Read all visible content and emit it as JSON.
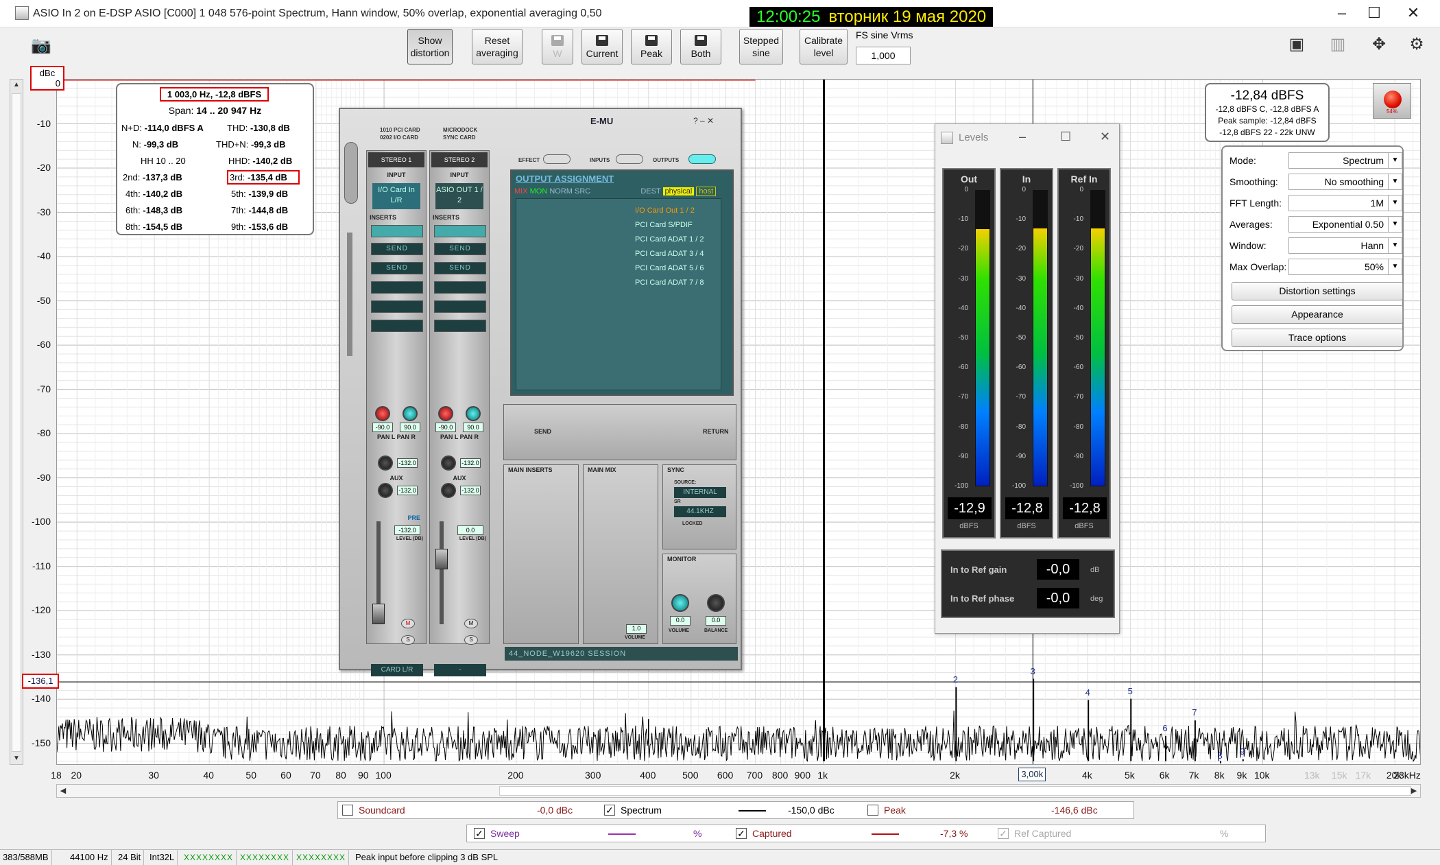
{
  "window": {
    "title": "ASIO In 2 on E-DSP ASIO [C000] 1 048 576-point Spectrum, Hann window, 50% overlap, exponential averaging 0,50",
    "clock_time": "12:00:25",
    "clock_date": "вторник 19 мая 2020"
  },
  "toolbar": {
    "show_distortion": "Show distortion",
    "reset_averaging": "Reset averaging",
    "w": "W",
    "current": "Current",
    "peak": "Peak",
    "both": "Both",
    "stepped_sine": "Stepped sine",
    "calibrate_level": "Calibrate level",
    "fs_sine_label": "FS sine Vrms",
    "fs_sine_value": "1,000"
  },
  "plot": {
    "y_unit": "dBc",
    "y_top": "0",
    "y_labels": [
      "-10",
      "-20",
      "-30",
      "-40",
      "-50",
      "-60",
      "-70",
      "-80",
      "-90",
      "-100",
      "-110",
      "-120",
      "-130",
      "-140",
      "-150"
    ],
    "cursor_level": "-136,1",
    "x_labels": [
      "18",
      "20",
      "30",
      "40",
      "50",
      "60",
      "70",
      "80",
      "90",
      "100",
      "200",
      "300",
      "400",
      "500",
      "600",
      "700",
      "800",
      "900",
      "1k",
      "2k",
      "3,00k",
      "4k",
      "5k",
      "6k",
      "7k",
      "8k",
      "9k",
      "10k",
      "13k",
      "15k",
      "17k",
      "20k",
      "23kHz"
    ],
    "cursor_freq": "3,00k",
    "harmonics": [
      "2",
      "3",
      "4",
      "5",
      "6",
      "7",
      "8",
      "9"
    ]
  },
  "chart_data": {
    "type": "line",
    "x_scale": "log",
    "x_unit": "Hz",
    "y_unit": "dBc",
    "ylim": [
      -155,
      0
    ],
    "xlim": [
      18,
      23000
    ],
    "noise_floor_db": -150,
    "cursor_level_db": -136.1,
    "cursor_freq_hz": 3000,
    "peaks": [
      {
        "label": "1",
        "freq": 1003,
        "db": 0
      },
      {
        "label": "2",
        "freq": 2006,
        "db": -137.3
      },
      {
        "label": "3",
        "freq": 3009,
        "db": -135.4
      },
      {
        "label": "4",
        "freq": 4012,
        "db": -140.2
      },
      {
        "label": "5",
        "freq": 5015,
        "db": -139.9
      },
      {
        "label": "6",
        "freq": 6018,
        "db": -148.3
      },
      {
        "label": "7",
        "freq": 7021,
        "db": -144.8
      },
      {
        "label": "8",
        "freq": 8024,
        "db": -154.5
      },
      {
        "label": "9",
        "freq": 9027,
        "db": -153.6
      }
    ]
  },
  "distortion": {
    "header": "1 003,0 Hz, -12,8 dBFS",
    "span_label": "Span:",
    "span_value": "14 .. 20 947 Hz",
    "nd_label": "N+D:",
    "nd_value": "-114,0 dBFS A",
    "thd_label": "THD:",
    "thd_value": "-130,8 dB",
    "n_label": "N:",
    "n_value": "-99,3 dB",
    "thdn_label": "THD+N:",
    "thdn_value": "-99,3 dB",
    "hh_label": "HH 10 .. 20",
    "hhd_label": "HHD:",
    "hhd_value": "-140,2 dB",
    "h2_label": "2nd:",
    "h2_value": "-137,3 dB",
    "h3_label": "3rd:",
    "h3_value": "-135,4 dB",
    "h4_label": "4th:",
    "h4_value": "-140,2 dB",
    "h5_label": "5th:",
    "h5_value": "-139,9 dB",
    "h6_label": "6th:",
    "h6_value": "-148,3 dB",
    "h7_label": "7th:",
    "h7_value": "-144,8 dB",
    "h8_label": "8th:",
    "h8_value": "-154,5 dB",
    "h9_label": "9th:",
    "h9_value": "-153,6 dB"
  },
  "levelbox": {
    "main": "-12,84 dBFS",
    "line1": "-12,8 dBFS C, -12,8 dBFS A",
    "line2": "Peak sample: -12,84 dBFS",
    "line3": "-12,8 dBFS 22 - 22k UNW",
    "rec_pct": "54%"
  },
  "settings": {
    "mode_label": "Mode:",
    "mode_value": "Spectrum",
    "smoothing_label": "Smoothing:",
    "smoothing_value": "No  smoothing",
    "fft_label": "FFT Length:",
    "fft_value": "1M",
    "averages_label": "Averages:",
    "averages_value": "Exponential 0.50",
    "window_label": "Window:",
    "window_value": "Hann",
    "overlap_label": "Max Overlap:",
    "overlap_value": "50%",
    "distortion_settings": "Distortion settings",
    "appearance": "Appearance",
    "trace_options": "Trace options"
  },
  "emu": {
    "logo": "E-MU",
    "card1": "1010 PCI CARD",
    "card2": "0202 I/O CARD",
    "card3": "MICRODOCK",
    "card4": "SYNC CARD",
    "effect": "EFFECT",
    "inputs": "INPUTS",
    "outputs": "OUTPUTS",
    "strip1_name": "STEREO  1",
    "strip2_name": "STEREO  2",
    "input_label": "INPUT",
    "strip1_input": "I/O Card In L/R",
    "strip2_input": "ASIO OUT 1 / 2",
    "inserts_label": "INSERTS",
    "send": "SEND",
    "pan_l": "PAN L",
    "pan_r": "PAN R",
    "pan_val": "-90.0",
    "pan_val_r": "90.0",
    "aux_label": "AUX",
    "aux_val": "-132.0",
    "level_label": "LEVEL (DB)",
    "pre": "PRE",
    "strip1_level": "-132.0",
    "strip2_level": "0.0",
    "m": "M",
    "s": "S",
    "strip1_card": "CARD L/R",
    "strip2_card": "-",
    "out_title": "OUTPUT ASSIGNMENT",
    "mix": "MIX",
    "mon": "MON",
    "norm": "NORM",
    "src": "SRC",
    "dest": "DEST",
    "physical": "physical",
    "host": "host",
    "outs": [
      "I/O Card Out 1 / 2",
      "PCI Card S/PDIF",
      "PCI Card ADAT 1 / 2",
      "PCI Card ADAT 3 / 4",
      "PCI Card ADAT 5 / 6",
      "PCI Card ADAT 7 / 8"
    ],
    "send_lbl": "SEND",
    "return_lbl": "RETURN",
    "main_inserts": "MAIN INSERTS",
    "main_mix": "MAIN MIX",
    "sync": "SYNC",
    "source": "SOURCE:",
    "internal": "INTERNAL",
    "sr": "SR",
    "sr_value": "44.1KHZ",
    "locked": "LOCKED",
    "monitor": "MONITOR",
    "volume": "VOLUME",
    "balance": "BALANCE",
    "vol_val": "1.0",
    "mon_vol": "0.0",
    "bal_val": "0.0",
    "session": "44_NODE_W19620 SESSION"
  },
  "levels": {
    "title": "Levels",
    "out_label": "Out",
    "in_label": "In",
    "ref_label": "Ref In",
    "ticks": [
      "0",
      "-10",
      "-20",
      "-30",
      "-40",
      "-50",
      "-60",
      "-70",
      "-80",
      "-90",
      "-100"
    ],
    "out_value": "-12,9",
    "in_value": "-12,8",
    "ref_value": "-12,8",
    "out_level_db": -12.9,
    "in_level_db": -12.8,
    "ref_level_db": -12.8,
    "unit": "dBFS",
    "gain_label": "In to Ref gain",
    "gain_value": "-0,0",
    "gain_unit": "dB",
    "phase_label": "In to Ref phase",
    "phase_value": "-0,0",
    "phase_unit": "deg"
  },
  "legend": {
    "soundcard": "Soundcard",
    "soundcard_val": "-0,0 dBc",
    "spectrum": "Spectrum",
    "spectrum_val": "-150,0 dBc",
    "peak": "Peak",
    "peak_val": "-146,6 dBc",
    "sweep": "Sweep",
    "sweep_val": "%",
    "captured": "Captured",
    "captured_val": "-7,3 %",
    "ref_captured": "Ref Captured",
    "ref_captured_val": "%",
    "color_spectrum": "#000000",
    "color_sweep": "#9b2fae",
    "color_captured": "#b01010"
  },
  "status": {
    "mem": "383/588MB",
    "rate": "44100 Hz",
    "bits": "24 Bit",
    "fmt": "Int32L",
    "ind1": "XXXXXXXX",
    "ind2": "XXXXXXXX",
    "ind3": "XXXXXXXX",
    "msg": "Peak input before clipping 3 dB SPL"
  }
}
